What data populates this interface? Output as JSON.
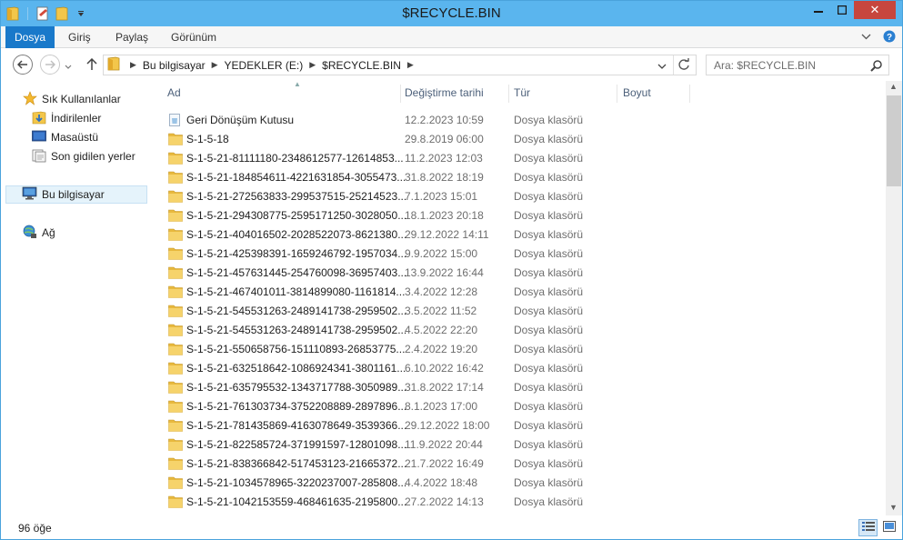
{
  "window": {
    "title": "$RECYCLE.BIN",
    "min_label": "─",
    "max_label": "□",
    "close_label": "✕"
  },
  "ribbon": {
    "tabs": [
      {
        "label": "Dosya"
      },
      {
        "label": "Giriş"
      },
      {
        "label": "Paylaş"
      },
      {
        "label": "Görünüm"
      }
    ]
  },
  "address": {
    "crumbs": [
      "Bu bilgisayar",
      "YEDEKLER (E:)",
      "$RECYCLE.BIN"
    ],
    "search_placeholder": "Ara: $RECYCLE.BIN"
  },
  "navpane": {
    "favorites_label": "Sık Kullanılanlar",
    "favorites": [
      "İndirilenler",
      "Masaüstü",
      "Son gidilen yerler"
    ],
    "this_pc_label": "Bu bilgisayar",
    "network_label": "Ağ"
  },
  "columns": {
    "name": "Ad",
    "date": "Değiştirme tarihi",
    "type": "Tür",
    "size": "Boyut"
  },
  "files": [
    {
      "name": "Geri Dönüşüm Kutusu",
      "date": "12.2.2023 10:59",
      "type": "Dosya klasörü",
      "icon": "recycle-bin-icon"
    },
    {
      "name": "S-1-5-18",
      "date": "29.8.2019 06:00",
      "type": "Dosya klasörü",
      "icon": "folder-icon"
    },
    {
      "name": "S-1-5-21-81111180-2348612577-12614853...",
      "date": "11.2.2023 12:03",
      "type": "Dosya klasörü",
      "icon": "folder-icon"
    },
    {
      "name": "S-1-5-21-184854611-4221631854-3055473...",
      "date": "31.8.2022 18:19",
      "type": "Dosya klasörü",
      "icon": "folder-icon"
    },
    {
      "name": "S-1-5-21-272563833-299537515-25214523...",
      "date": "7.1.2023 15:01",
      "type": "Dosya klasörü",
      "icon": "folder-icon"
    },
    {
      "name": "S-1-5-21-294308775-2595171250-3028050...",
      "date": "18.1.2023 20:18",
      "type": "Dosya klasörü",
      "icon": "folder-icon"
    },
    {
      "name": "S-1-5-21-404016502-2028522073-8621380...",
      "date": "29.12.2022 14:11",
      "type": "Dosya klasörü",
      "icon": "folder-icon"
    },
    {
      "name": "S-1-5-21-425398391-1659246792-1957034...",
      "date": "9.9.2022 15:00",
      "type": "Dosya klasörü",
      "icon": "folder-icon"
    },
    {
      "name": "S-1-5-21-457631445-254760098-36957403...",
      "date": "13.9.2022 16:44",
      "type": "Dosya klasörü",
      "icon": "folder-icon"
    },
    {
      "name": "S-1-5-21-467401011-3814899080-1161814...",
      "date": "3.4.2022 12:28",
      "type": "Dosya klasörü",
      "icon": "folder-icon"
    },
    {
      "name": "S-1-5-21-545531263-2489141738-2959502...",
      "date": "3.5.2022 11:52",
      "type": "Dosya klasörü",
      "icon": "folder-icon"
    },
    {
      "name": "S-1-5-21-545531263-2489141738-2959502...",
      "date": "4.5.2022 22:20",
      "type": "Dosya klasörü",
      "icon": "folder-icon"
    },
    {
      "name": "S-1-5-21-550658756-151110893-26853775...",
      "date": "2.4.2022 19:20",
      "type": "Dosya klasörü",
      "icon": "folder-icon"
    },
    {
      "name": "S-1-5-21-632518642-1086924341-3801161...",
      "date": "6.10.2022 16:42",
      "type": "Dosya klasörü",
      "icon": "folder-icon"
    },
    {
      "name": "S-1-5-21-635795532-1343717788-3050989...",
      "date": "31.8.2022 17:14",
      "type": "Dosya klasörü",
      "icon": "folder-icon"
    },
    {
      "name": "S-1-5-21-761303734-3752208889-2897896...",
      "date": "8.1.2023 17:00",
      "type": "Dosya klasörü",
      "icon": "folder-icon"
    },
    {
      "name": "S-1-5-21-781435869-4163078649-3539366...",
      "date": "29.12.2022 18:00",
      "type": "Dosya klasörü",
      "icon": "folder-icon"
    },
    {
      "name": "S-1-5-21-822585724-371991597-12801098...",
      "date": "11.9.2022 20:44",
      "type": "Dosya klasörü",
      "icon": "folder-icon"
    },
    {
      "name": "S-1-5-21-838366842-517453123-21665372...",
      "date": "21.7.2022 16:49",
      "type": "Dosya klasörü",
      "icon": "folder-icon"
    },
    {
      "name": "S-1-5-21-1034578965-3220237007-285808...",
      "date": "4.4.2022 18:48",
      "type": "Dosya klasörü",
      "icon": "folder-icon"
    },
    {
      "name": "S-1-5-21-1042153559-468461635-2195800...",
      "date": "27.2.2022 14:13",
      "type": "Dosya klasörü",
      "icon": "folder-icon"
    }
  ],
  "status": {
    "item_count": "96 öğe"
  },
  "colors": {
    "titlebar": "#5ab5ee",
    "file_tab": "#1979ca",
    "close": "#c7463e",
    "folder": "#e8b93e",
    "selection": "#e5f3fb"
  }
}
